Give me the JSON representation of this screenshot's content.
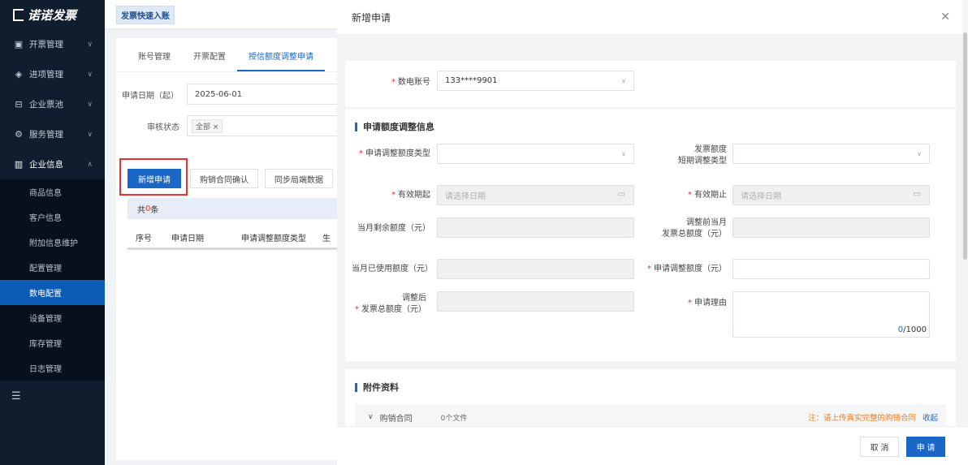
{
  "app": {
    "logo_text": "诺诺发票",
    "breadcrumb": "发票快速入账"
  },
  "sidebar": {
    "menus": [
      {
        "label": "开票管理",
        "icon": "invoice-icon"
      },
      {
        "label": "进项管理",
        "icon": "layers-icon"
      },
      {
        "label": "企业票池",
        "icon": "wallet-icon"
      },
      {
        "label": "服务管理",
        "icon": "service-icon"
      },
      {
        "label": "企业信息",
        "icon": "building-icon"
      }
    ],
    "sub_items": [
      "商品信息",
      "客户信息",
      "附加信息维护",
      "配置管理",
      "数电配置",
      "设备管理",
      "库存管理",
      "日志管理"
    ],
    "active_sub": "数电配置",
    "collapse_icon": "menu-fold-icon"
  },
  "main": {
    "tabs": [
      "账号管理",
      "开票配置",
      "授信额度调整申请"
    ],
    "active_tab": "授信额度调整申请",
    "filter_date_label": "申请日期（起）",
    "filter_date_value": "2025-06-01",
    "filter_status_label": "审核状态",
    "filter_status_tag": "全部",
    "btn_new": "新增申请",
    "btn_contract": "购销合同确认",
    "btn_sync": "同步局端数据",
    "count_prefix": "共",
    "count_value": "0",
    "count_suffix": "条",
    "table_headers": [
      "序号",
      "申请日期",
      "申请调整额度类型",
      "生"
    ]
  },
  "dialog": {
    "title": "新增申请",
    "close_icon": "close-icon",
    "account_label": "数电账号",
    "account_value": "133****9901",
    "section1_title": "申请额度调整信息",
    "fields": {
      "adjust_type_label": "申请调整额度类型",
      "short_term_label_1": "发票额度",
      "short_term_label_2": "短期调整类型",
      "valid_from_label": "有效期起",
      "valid_from_placeholder": "请选择日期",
      "valid_to_label": "有效期止",
      "valid_to_placeholder": "请选择日期",
      "month_remaining_label": "当月剩余额度（元）",
      "before_total_label_1": "调整前当月",
      "before_total_label_2": "发票总额度（元）",
      "month_used_label": "当月已使用额度（元）",
      "adjust_amount_label": "申请调整额度（元）",
      "after_total_label_1": "调整后",
      "after_total_label_2": "发票总额度（元）",
      "reason_label": "申请理由",
      "reason_count": "0",
      "reason_max": "/1000"
    },
    "section2_title": "附件资料",
    "attachment": {
      "name": "购销合同",
      "files": "0个文件",
      "note": "注：请上传真实完整的购销合同",
      "collapse": "收起"
    },
    "btn_cancel": "取 消",
    "btn_submit": "申 请"
  },
  "colors": {
    "primary": "#1b67c7",
    "sidebar": "#0f1d2e",
    "required": "#e3342f",
    "note": "#f37b1d"
  }
}
